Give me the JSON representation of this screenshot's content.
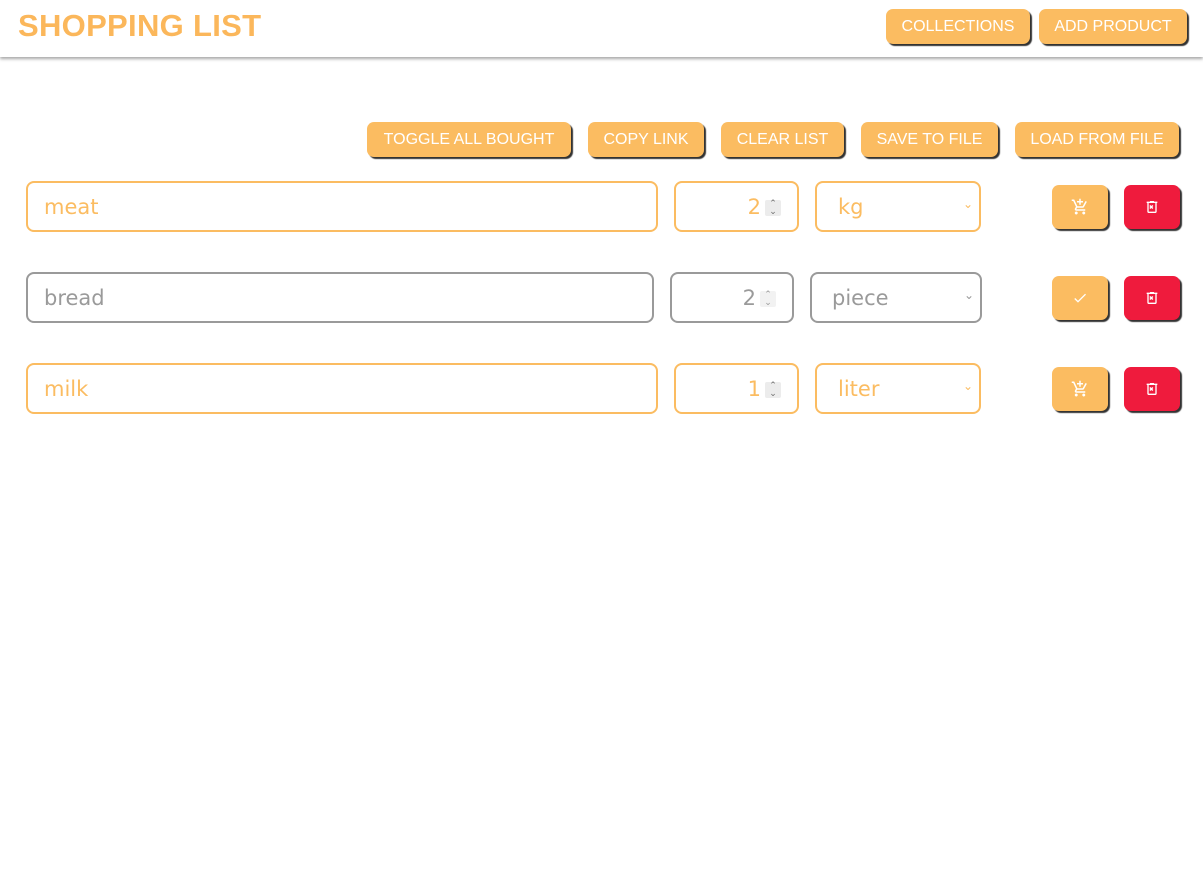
{
  "header": {
    "title": "SHOPPING LIST",
    "collections_label": "COLLECTIONS",
    "add_product_label": "ADD PRODUCT"
  },
  "toolbar": {
    "toggle_all_bought": "TOGGLE ALL BOUGHT",
    "copy_link": "COPY LINK",
    "clear_list": "CLEAR LIST",
    "save_to_file": "SAVE TO FILE",
    "load_from_file": "LOAD FROM FILE"
  },
  "items": [
    {
      "name": "meat",
      "quantity": "2",
      "unit": "kg",
      "bought": false,
      "action_icon": "add-to-cart-icon"
    },
    {
      "name": "bread",
      "quantity": "2",
      "unit": "piece",
      "bought": true,
      "action_icon": "checkmark-icon"
    },
    {
      "name": "milk",
      "quantity": "1",
      "unit": "liter",
      "bought": false,
      "action_icon": "add-to-cart-icon"
    }
  ],
  "colors": {
    "accent": "#fbbc61",
    "delete": "#ef1b3d",
    "bought_border": "#9a9a9a"
  }
}
